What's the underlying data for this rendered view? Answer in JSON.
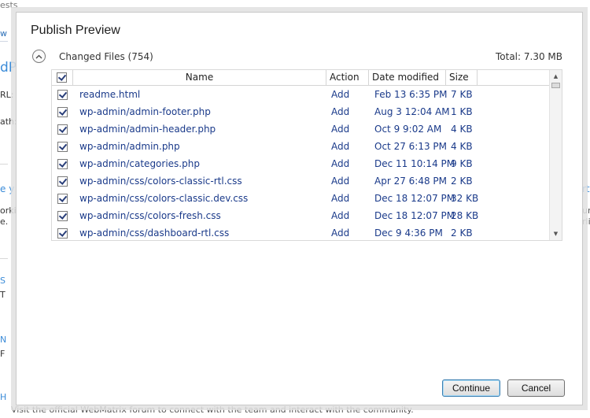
{
  "background": {
    "tab_fragment": "ests",
    "link_fragment": "w",
    "big_fragment": "dP",
    "url_label": "RL:",
    "path_label": "ath:",
    "blue1": "e y",
    "work_fragment": "orki",
    "e_fragment": "e.",
    "s_fragment": "S",
    "t_fragment": "T",
    "n_fragment": "N",
    "f_fragment": "F",
    "h_fragment": "H",
    "right_blue": "rt",
    "right_ur": "ur",
    "right_rli": "rli",
    "footer": "Visit the official WebMatrix forum to connect with the team and interact with the community."
  },
  "dialog": {
    "title": "Publish Preview",
    "section_label": "Changed Files (754)",
    "total": "Total: 7.30 MB"
  },
  "icons": {
    "collapse": "chevron-up-icon",
    "scroll_up": "scroll-up-icon",
    "scroll_down": "scroll-down-icon"
  },
  "table": {
    "columns": {
      "name": "Name",
      "action": "Action",
      "date": "Date modified",
      "size": "Size"
    },
    "rows": [
      {
        "name": "readme.html",
        "action": "Add",
        "date": "Feb 13 6:35 PM",
        "size": "7 KB"
      },
      {
        "name": "wp-admin/admin-footer.php",
        "action": "Add",
        "date": "Aug 3 12:04 AM",
        "size": "1 KB"
      },
      {
        "name": "wp-admin/admin-header.php",
        "action": "Add",
        "date": "Oct 9 9:02 AM",
        "size": "4 KB"
      },
      {
        "name": "wp-admin/admin.php",
        "action": "Add",
        "date": "Oct 27 6:13 PM",
        "size": "4 KB"
      },
      {
        "name": "wp-admin/categories.php",
        "action": "Add",
        "date": "Dec 11 10:14 PM",
        "size": "9 KB"
      },
      {
        "name": "wp-admin/css/colors-classic-rtl.css",
        "action": "Add",
        "date": "Apr 27 6:48 PM",
        "size": "2 KB"
      },
      {
        "name": "wp-admin/css/colors-classic.dev.css",
        "action": "Add",
        "date": "Dec 18 12:07 PM",
        "size": "32 KB"
      },
      {
        "name": "wp-admin/css/colors-fresh.css",
        "action": "Add",
        "date": "Dec 18 12:07 PM",
        "size": "28 KB"
      },
      {
        "name": "wp-admin/css/dashboard-rtl.css",
        "action": "Add",
        "date": "Dec 9 4:36 PM",
        "size": "2 KB"
      }
    ]
  },
  "buttons": {
    "continue": "Continue",
    "cancel": "Cancel"
  }
}
